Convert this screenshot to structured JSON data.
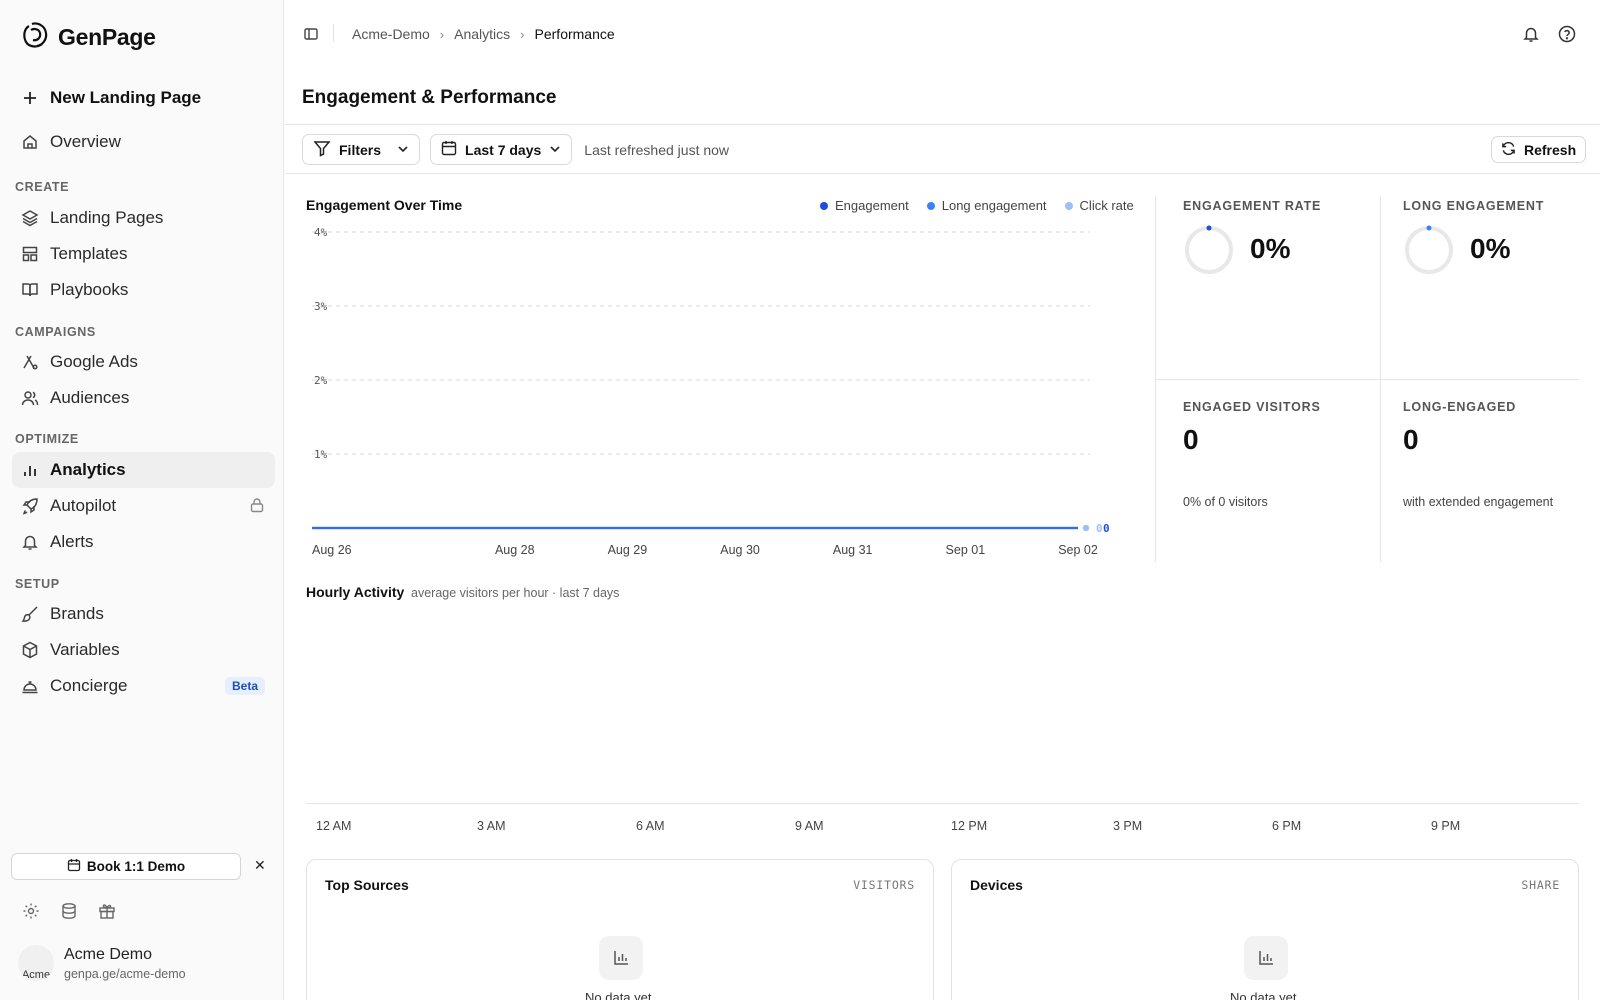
{
  "app": {
    "name": "GenPage"
  },
  "sidebar": {
    "new_page_label": "New Landing Page",
    "overview_label": "Overview",
    "sections": {
      "create": "CREATE",
      "campaigns": "CAMPAIGNS",
      "optimize": "OPTIMIZE",
      "setup": "SETUP"
    },
    "items": {
      "landing_pages": "Landing Pages",
      "templates": "Templates",
      "playbooks": "Playbooks",
      "google_ads": "Google Ads",
      "audiences": "Audiences",
      "analytics": "Analytics",
      "autopilot": "Autopilot",
      "alerts": "Alerts",
      "brands": "Brands",
      "variables": "Variables",
      "concierge": "Concierge"
    },
    "beta_badge": "Beta",
    "demo_button": "Book 1:1 Demo",
    "close_glyph": "✕",
    "profile": {
      "name": "Acme Demo",
      "url": "genpa.ge/acme-demo",
      "avatar_alt": "Acme"
    }
  },
  "breadcrumb": [
    "Acme-Demo",
    "Analytics",
    "Performance"
  ],
  "breadcrumb_sep": "›",
  "page_title": "Engagement & Performance",
  "toolbar": {
    "filters_label": "Filters",
    "range_label": "Last 7 days",
    "refreshed_text": "Last refreshed just now",
    "refresh_label": "Refresh"
  },
  "chart_data": {
    "type": "line",
    "title": "Engagement Over Time",
    "x": [
      "Aug 26",
      "Aug 28",
      "Aug 29",
      "Aug 30",
      "Aug 31",
      "Sep 01",
      "Sep 02"
    ],
    "y_ticks": [
      "1%",
      "2%",
      "3%",
      "4%"
    ],
    "ylim": [
      0,
      4
    ],
    "series": [
      {
        "name": "Engagement",
        "color": "#1d4fd8",
        "values": [
          0,
          0,
          0,
          0,
          0,
          0,
          0
        ]
      },
      {
        "name": "Long engagement",
        "color": "#3b82f6",
        "values": [
          0,
          0,
          0,
          0,
          0,
          0,
          0
        ]
      },
      {
        "name": "Click rate",
        "color": "#9cc0f5",
        "values": [
          0,
          0,
          0,
          0,
          0,
          0,
          0
        ]
      }
    ],
    "end_labels": [
      "0",
      "0"
    ],
    "grid": true,
    "legend": "top-right"
  },
  "kpis": {
    "engagement_rate": {
      "label": "ENGAGEMENT RATE",
      "value": "0%",
      "progress": 0
    },
    "long_engagement": {
      "label": "LONG ENGAGEMENT",
      "value": "0%",
      "progress": 0
    },
    "engaged_visitors": {
      "label": "ENGAGED VISITORS",
      "value": "0",
      "sub": "0% of 0 visitors"
    },
    "long_engaged": {
      "label": "LONG-ENGAGED",
      "value": "0",
      "sub": "with extended engagement"
    }
  },
  "hourly": {
    "title": "Hourly Activity",
    "subtitle": "average visitors per hour · last 7 days",
    "hours": [
      "12 AM",
      "3 AM",
      "6 AM",
      "9 AM",
      "12 PM",
      "3 PM",
      "6 PM",
      "9 PM"
    ]
  },
  "top_sources": {
    "title": "Top Sources",
    "meta": "VISITORS",
    "empty": "No data yet"
  },
  "devices": {
    "title": "Devices",
    "meta": "SHARE",
    "empty": "No data yet"
  },
  "colors": {
    "accent": "#1d4fd8",
    "beta_bg": "#e6effd"
  }
}
